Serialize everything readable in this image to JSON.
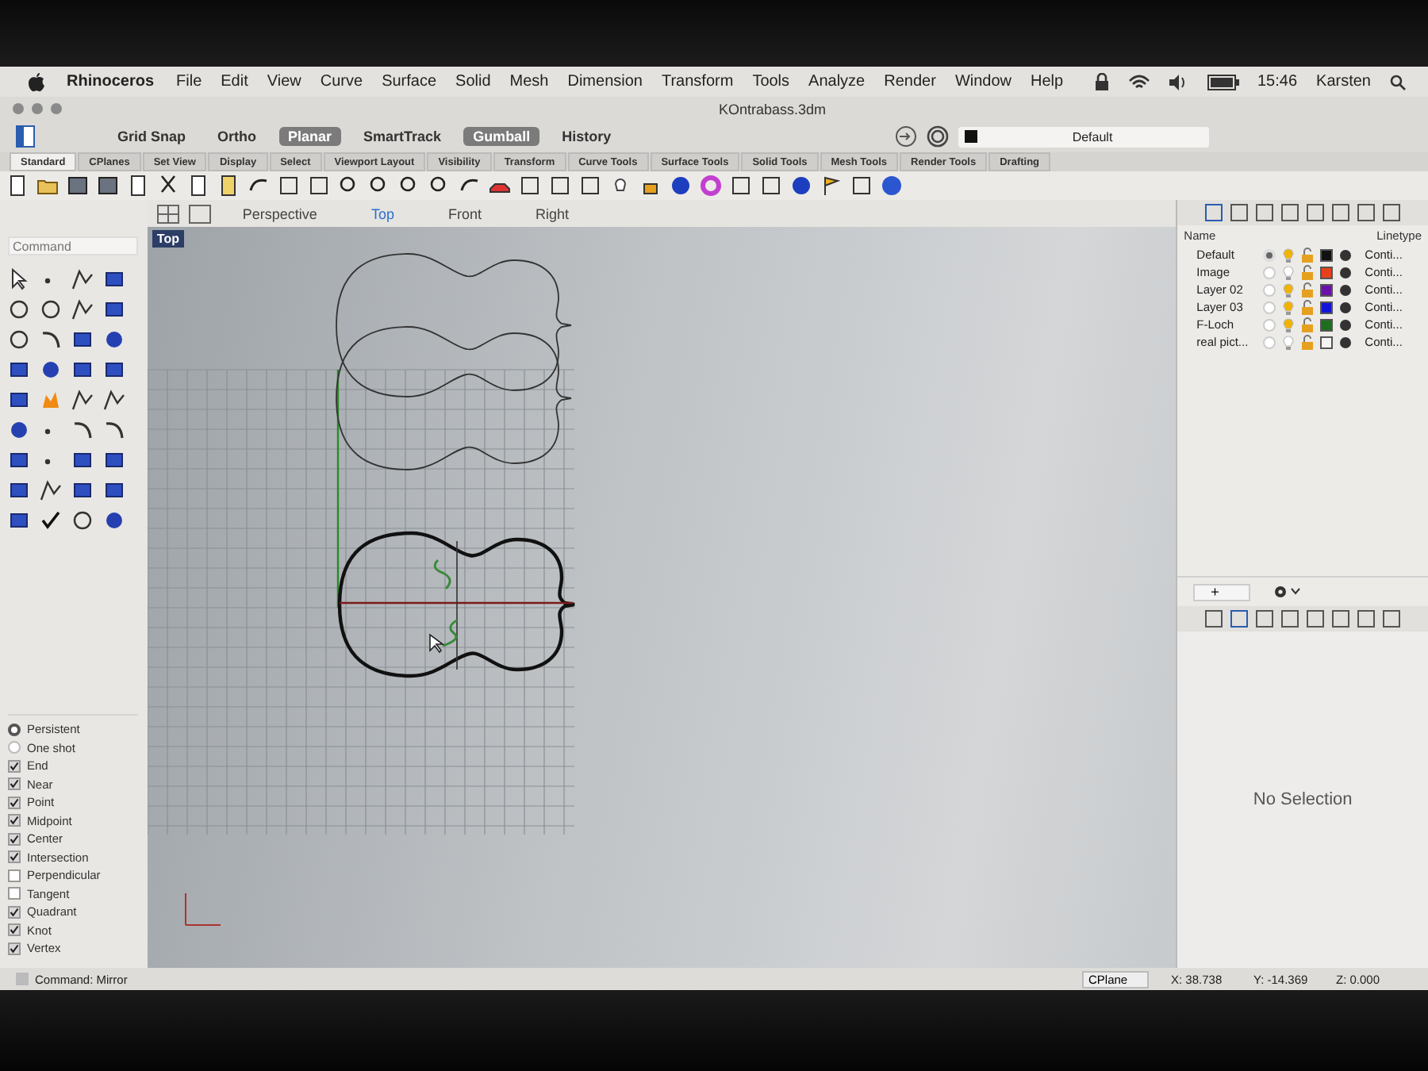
{
  "menu_bar": {
    "app": "Rhinoceros",
    "items": [
      "File",
      "Edit",
      "View",
      "Curve",
      "Surface",
      "Solid",
      "Mesh",
      "Dimension",
      "Transform",
      "Tools",
      "Analyze",
      "Render",
      "Window",
      "Help"
    ],
    "clock": "15:46",
    "user": "Karsten"
  },
  "window": {
    "title": "KOntrabass.3dm"
  },
  "modes": [
    {
      "label": "Grid Snap",
      "selected": false
    },
    {
      "label": "Ortho",
      "selected": false
    },
    {
      "label": "Planar",
      "selected": true
    },
    {
      "label": "SmartTrack",
      "selected": false
    },
    {
      "label": "Gumball",
      "selected": true
    },
    {
      "label": "History",
      "selected": false
    }
  ],
  "layer_dropdown": {
    "value": "Default"
  },
  "tabs": [
    {
      "label": "Standard",
      "selected": true
    },
    {
      "label": "CPlanes",
      "selected": false
    },
    {
      "label": "Set View",
      "selected": false
    },
    {
      "label": "Display",
      "selected": false
    },
    {
      "label": "Select",
      "selected": false
    },
    {
      "label": "Viewport Layout",
      "selected": false
    },
    {
      "label": "Visibility",
      "selected": false
    },
    {
      "label": "Transform",
      "selected": false
    },
    {
      "label": "Curve Tools",
      "selected": false
    },
    {
      "label": "Surface Tools",
      "selected": false
    },
    {
      "label": "Solid Tools",
      "selected": false
    },
    {
      "label": "Mesh Tools",
      "selected": false
    },
    {
      "label": "Render Tools",
      "selected": false
    },
    {
      "label": "Drafting",
      "selected": false
    }
  ],
  "command_field": {
    "placeholder": "Command"
  },
  "viewport_tabs": [
    {
      "label": "Perspective",
      "selected": false
    },
    {
      "label": "Top",
      "selected": true
    },
    {
      "label": "Front",
      "selected": false
    },
    {
      "label": "Right",
      "selected": false
    }
  ],
  "viewport_label": "Top",
  "osnap": {
    "modes": [
      {
        "label": "Persistent",
        "selected": true
      },
      {
        "label": "One shot",
        "selected": false
      }
    ],
    "items": [
      {
        "label": "End",
        "checked": true
      },
      {
        "label": "Near",
        "checked": true
      },
      {
        "label": "Point",
        "checked": true
      },
      {
        "label": "Midpoint",
        "checked": true
      },
      {
        "label": "Center",
        "checked": true
      },
      {
        "label": "Intersection",
        "checked": true
      },
      {
        "label": "Perpendicular",
        "checked": false
      },
      {
        "label": "Tangent",
        "checked": false
      },
      {
        "label": "Quadrant",
        "checked": true
      },
      {
        "label": "Knot",
        "checked": true
      },
      {
        "label": "Vertex",
        "checked": true
      }
    ]
  },
  "layers": {
    "columns": [
      "Name",
      "Linetype"
    ],
    "rows": [
      {
        "name": "Default",
        "current": true,
        "visible": true,
        "color": "#111111",
        "linetype": "Conti..."
      },
      {
        "name": "Image",
        "current": false,
        "visible": false,
        "color": "#e8401c",
        "linetype": "Conti..."
      },
      {
        "name": "Layer 02",
        "current": false,
        "visible": true,
        "color": "#6a12a8",
        "linetype": "Conti..."
      },
      {
        "name": "Layer 03",
        "current": false,
        "visible": true,
        "color": "#1414d8",
        "linetype": "Conti..."
      },
      {
        "name": "F-Loch",
        "current": false,
        "visible": true,
        "color": "#1e6e1e",
        "linetype": "Conti..."
      },
      {
        "name": "real pict...",
        "current": false,
        "visible": false,
        "color": "#f4f4f4",
        "linetype": "Conti..."
      }
    ],
    "add_button": "+"
  },
  "properties": {
    "message": "No Selection"
  },
  "status_bar": {
    "command": "Command: Mirror",
    "cplane": "CPlane",
    "x": "X: 38.738",
    "y": "Y: -14.369",
    "z": "Z: 0.000"
  }
}
